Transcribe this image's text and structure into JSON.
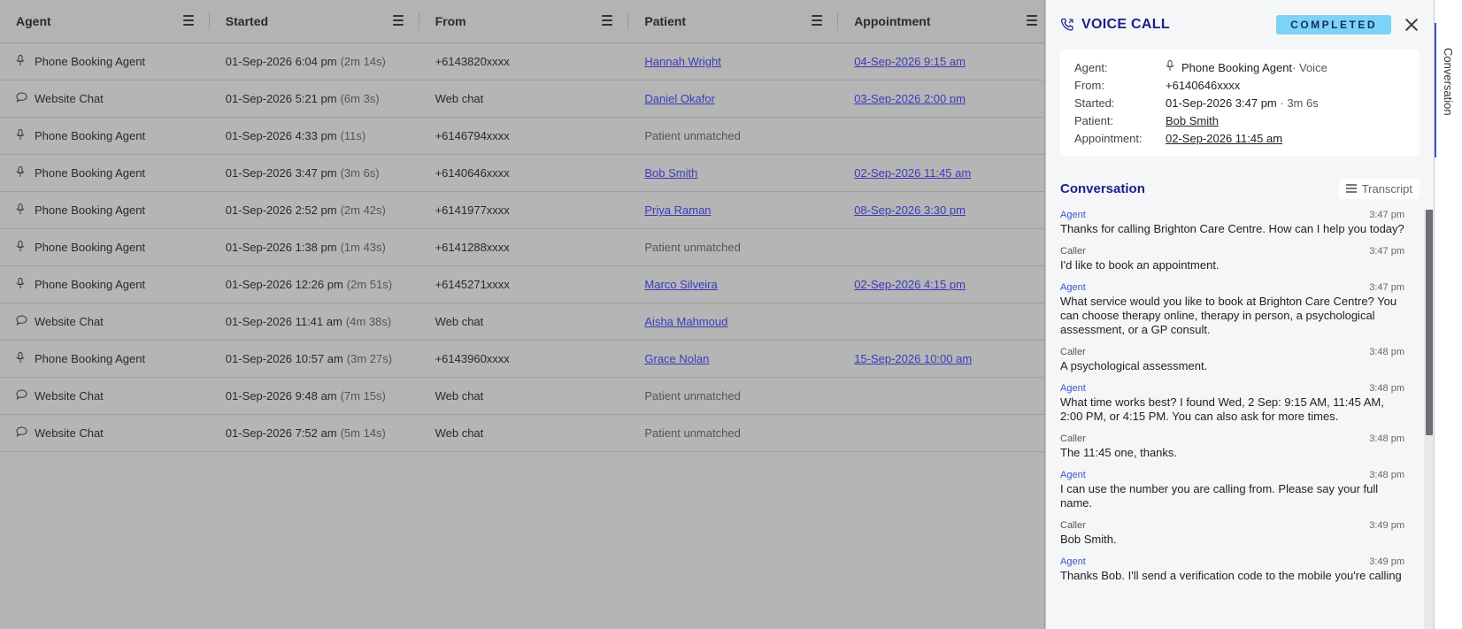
{
  "table": {
    "columns": [
      "Agent",
      "Started",
      "From",
      "Patient",
      "Appointment"
    ],
    "rows": [
      {
        "agent": "Phone Booking Agent",
        "icon": "microphone-icon",
        "started": "01-Sep-2026 6:04 pm",
        "duration": "(2m 14s)",
        "from": "+6143820xxxx",
        "patient": "Hannah Wright",
        "appointment": "04-Sep-2026 9:15 am"
      },
      {
        "agent": "Website Chat",
        "icon": "chat-bubble-icon",
        "started": "01-Sep-2026 5:21 pm",
        "duration": "(6m 3s)",
        "from": "Web chat",
        "patient": "Daniel Okafor",
        "appointment": "03-Sep-2026 2:00 pm"
      },
      {
        "agent": "Phone Booking Agent",
        "icon": "microphone-icon",
        "started": "01-Sep-2026 4:33 pm",
        "duration": "(11s)",
        "from": "+6146794xxxx",
        "patient": "Patient unmatched",
        "appointment": ""
      },
      {
        "agent": "Phone Booking Agent",
        "icon": "microphone-icon",
        "started": "01-Sep-2026 3:47 pm",
        "duration": "(3m 6s)",
        "from": "+6140646xxxx",
        "patient": "Bob Smith",
        "appointment": "02-Sep-2026 11:45 am"
      },
      {
        "agent": "Phone Booking Agent",
        "icon": "microphone-icon",
        "started": "01-Sep-2026 2:52 pm",
        "duration": "(2m 42s)",
        "from": "+6141977xxxx",
        "patient": "Priya Raman",
        "appointment": "08-Sep-2026 3:30 pm"
      },
      {
        "agent": "Phone Booking Agent",
        "icon": "microphone-icon",
        "started": "01-Sep-2026 1:38 pm",
        "duration": "(1m 43s)",
        "from": "+6141288xxxx",
        "patient": "Patient unmatched",
        "appointment": ""
      },
      {
        "agent": "Phone Booking Agent",
        "icon": "microphone-icon",
        "started": "01-Sep-2026 12:26 pm",
        "duration": "(2m 51s)",
        "from": "+6145271xxxx",
        "patient": "Marco Silveira",
        "appointment": "02-Sep-2026 4:15 pm"
      },
      {
        "agent": "Website Chat",
        "icon": "chat-bubble-icon",
        "started": "01-Sep-2026 11:41 am",
        "duration": "(4m 38s)",
        "from": "Web chat",
        "patient": "Aisha Mahmoud",
        "appointment": ""
      },
      {
        "agent": "Phone Booking Agent",
        "icon": "microphone-icon",
        "started": "01-Sep-2026 10:57 am",
        "duration": "(3m 27s)",
        "from": "+6143960xxxx",
        "patient": "Grace Nolan",
        "appointment": "15-Sep-2026 10:00 am"
      },
      {
        "agent": "Website Chat",
        "icon": "chat-bubble-icon",
        "started": "01-Sep-2026 9:48 am",
        "duration": "(7m 15s)",
        "from": "Web chat",
        "patient": "Patient unmatched",
        "appointment": ""
      },
      {
        "agent": "Website Chat",
        "icon": "chat-bubble-icon",
        "started": "01-Sep-2026 7:52 am",
        "duration": "(5m 14s)",
        "from": "Web chat",
        "patient": "Patient unmatched",
        "appointment": ""
      }
    ]
  },
  "panel": {
    "title": "VOICE CALL",
    "status": "COMPLETED",
    "status_color": "#7dd3f5",
    "info": {
      "agent_label": "Agent:",
      "agent_value": "Phone Booking Agent",
      "agent_suffix": "· Voice",
      "from_label": "From:",
      "from_value": "+6140646xxxx",
      "started_label": "Started:",
      "started_value": "01-Sep-2026 3:47 pm",
      "started_duration": "· 3m 6s",
      "patient_label": "Patient:",
      "patient_value": "Bob Smith",
      "appointment_label": "Appointment:",
      "appointment_value": "02-Sep-2026 11:45 am"
    },
    "conversation_title": "Conversation",
    "transcript_label": "Transcript",
    "messages": [
      {
        "who": "Agent",
        "time": "3:47 pm",
        "text": "Thanks for calling Brighton Care Centre. How can I help you today?"
      },
      {
        "who": "Caller",
        "time": "3:47 pm",
        "text": "I'd like to book an appointment."
      },
      {
        "who": "Agent",
        "time": "3:47 pm",
        "text": "What service would you like to book at Brighton Care Centre? You can choose therapy online, therapy in person, a psychological assessment, or a GP consult."
      },
      {
        "who": "Caller",
        "time": "3:48 pm",
        "text": "A psychological assessment."
      },
      {
        "who": "Agent",
        "time": "3:48 pm",
        "text": "What time works best? I found Wed, 2 Sep: 9:15 AM, 11:45 AM, 2:00 PM, or 4:15 PM. You can also ask for more times."
      },
      {
        "who": "Caller",
        "time": "3:48 pm",
        "text": "The 11:45 one, thanks."
      },
      {
        "who": "Agent",
        "time": "3:48 pm",
        "text": "I can use the number you are calling from. Please say your full name."
      },
      {
        "who": "Caller",
        "time": "3:49 pm",
        "text": "Bob Smith."
      },
      {
        "who": "Agent",
        "time": "3:49 pm",
        "text": "Thanks Bob. I'll send a verification code to the mobile you're calling"
      }
    ]
  },
  "side_tab": {
    "label": "Conversation"
  }
}
